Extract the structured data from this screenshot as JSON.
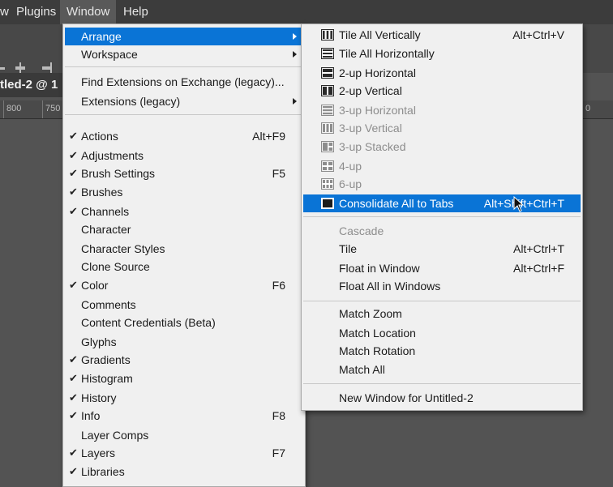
{
  "menubar": {
    "items": [
      {
        "label": "w"
      },
      {
        "label": "Plugins"
      },
      {
        "label": "Window"
      },
      {
        "label": "Help"
      }
    ]
  },
  "document": {
    "tab_title": "tled-2 @ 1",
    "ruler_labels": [
      "800",
      "750",
      "0"
    ]
  },
  "window_menu": {
    "arrange": "Arrange",
    "workspace": "Workspace",
    "find_extensions": "Find Extensions on Exchange (legacy)...",
    "extensions": "Extensions (legacy)",
    "panels": [
      {
        "label": "Actions",
        "checked": true,
        "shortcut": "Alt+F9"
      },
      {
        "label": "Adjustments",
        "checked": true,
        "shortcut": ""
      },
      {
        "label": "Brush Settings",
        "checked": true,
        "shortcut": "F5"
      },
      {
        "label": "Brushes",
        "checked": true,
        "shortcut": ""
      },
      {
        "label": "Channels",
        "checked": true,
        "shortcut": ""
      },
      {
        "label": "Character",
        "checked": false,
        "shortcut": ""
      },
      {
        "label": "Character Styles",
        "checked": false,
        "shortcut": ""
      },
      {
        "label": "Clone Source",
        "checked": false,
        "shortcut": ""
      },
      {
        "label": "Color",
        "checked": true,
        "shortcut": "F6"
      },
      {
        "label": "Comments",
        "checked": false,
        "shortcut": ""
      },
      {
        "label": "Content Credentials (Beta)",
        "checked": false,
        "shortcut": ""
      },
      {
        "label": "Glyphs",
        "checked": false,
        "shortcut": ""
      },
      {
        "label": "Gradients",
        "checked": true,
        "shortcut": ""
      },
      {
        "label": "Histogram",
        "checked": true,
        "shortcut": ""
      },
      {
        "label": "History",
        "checked": true,
        "shortcut": ""
      },
      {
        "label": "Info",
        "checked": true,
        "shortcut": "F8"
      },
      {
        "label": "Layer Comps",
        "checked": false,
        "shortcut": ""
      },
      {
        "label": "Layers",
        "checked": true,
        "shortcut": "F7"
      },
      {
        "label": "Libraries",
        "checked": true,
        "shortcut": ""
      }
    ]
  },
  "arrange_menu": {
    "layout_items": [
      {
        "label": "Tile All Vertically",
        "shortcut": "Alt+Ctrl+V",
        "icon": "tile-vertical-icon",
        "disabled": false
      },
      {
        "label": "Tile All Horizontally",
        "shortcut": "",
        "icon": "tile-horizontal-icon",
        "disabled": false
      },
      {
        "label": "2-up Horizontal",
        "shortcut": "",
        "icon": "two-up-horizontal-icon",
        "disabled": false
      },
      {
        "label": "2-up Vertical",
        "shortcut": "",
        "icon": "two-up-vertical-icon",
        "disabled": false
      },
      {
        "label": "3-up Horizontal",
        "shortcut": "",
        "icon": "three-up-horizontal-icon",
        "disabled": true
      },
      {
        "label": "3-up Vertical",
        "shortcut": "",
        "icon": "three-up-vertical-icon",
        "disabled": true
      },
      {
        "label": "3-up Stacked",
        "shortcut": "",
        "icon": "three-up-stacked-icon",
        "disabled": true
      },
      {
        "label": "4-up",
        "shortcut": "",
        "icon": "four-up-icon",
        "disabled": true
      },
      {
        "label": "6-up",
        "shortcut": "",
        "icon": "six-up-icon",
        "disabled": true
      },
      {
        "label": "Consolidate All to Tabs",
        "shortcut": "Alt+Shift+Ctrl+T",
        "icon": "consolidate-tabs-icon",
        "disabled": false,
        "highlighted": true
      }
    ],
    "window_items": [
      {
        "label": "Cascade",
        "shortcut": "",
        "disabled": true
      },
      {
        "label": "Tile",
        "shortcut": "Alt+Ctrl+T",
        "disabled": false
      },
      {
        "label": "Float in Window",
        "shortcut": "Alt+Ctrl+F",
        "disabled": false
      },
      {
        "label": "Float All in Windows",
        "shortcut": "",
        "disabled": false
      }
    ],
    "match_items": [
      {
        "label": "Match Zoom"
      },
      {
        "label": "Match Location"
      },
      {
        "label": "Match Rotation"
      },
      {
        "label": "Match All"
      }
    ],
    "new_window": "New Window for Untitled-2"
  },
  "colors": {
    "highlight": "#0a74d6",
    "menu_bg": "#f0f0f0",
    "app_bg": "#535353"
  }
}
